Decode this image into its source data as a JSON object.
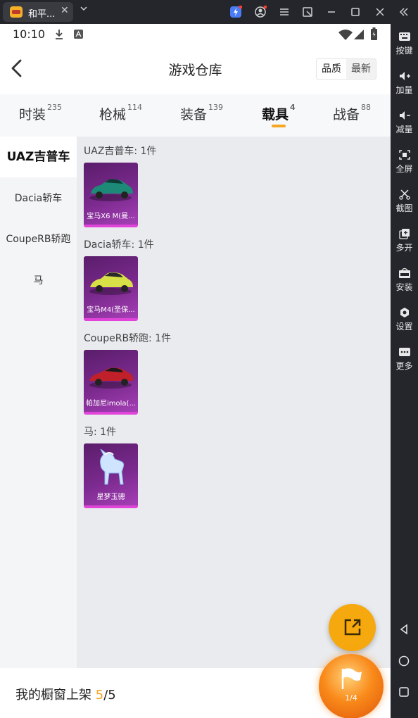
{
  "window": {
    "app_title": "和平...",
    "tab_close": "✕"
  },
  "sidebar": {
    "items": [
      {
        "label": "按键",
        "icon": "keyboard-icon"
      },
      {
        "label": "加量",
        "icon": "volume-up-icon"
      },
      {
        "label": "减量",
        "icon": "volume-down-icon"
      },
      {
        "label": "全屏",
        "icon": "fullscreen-icon"
      },
      {
        "label": "截图",
        "icon": "scissors-icon"
      },
      {
        "label": "多开",
        "icon": "multi-instance-icon"
      },
      {
        "label": "安装",
        "icon": "apk-icon"
      },
      {
        "label": "设置",
        "icon": "gear-icon"
      },
      {
        "label": "更多",
        "icon": "more-icon"
      }
    ]
  },
  "status": {
    "time": "10:10"
  },
  "header": {
    "title": "游戏仓库",
    "sort_quality": "品质",
    "sort_latest": "最新"
  },
  "tabs": [
    {
      "label": "时装",
      "count": "235"
    },
    {
      "label": "枪械",
      "count": "114"
    },
    {
      "label": "装备",
      "count": "139"
    },
    {
      "label": "载具",
      "count": "4",
      "active": true
    },
    {
      "label": "战备",
      "count": "88"
    }
  ],
  "categories": [
    "UAZ吉普车",
    "Dacia轿车",
    "CoupeRB轿跑",
    "马"
  ],
  "groups": [
    {
      "title": "UAZ吉普车: 1件",
      "item": "宝马X6 M(曼..."
    },
    {
      "title": "Dacia轿车: 1件",
      "item": "宝马M4(圣保..."
    },
    {
      "title": "CoupeRB轿跑: 1件",
      "item": "帕加尼imola(..."
    },
    {
      "title": "马: 1件",
      "item": "星梦玉骢"
    }
  ],
  "bottom": {
    "shelf_label": "我的橱窗上架 ",
    "shelf_count": "5",
    "shelf_total": "/5"
  },
  "flag_counter": "1/4",
  "colors": {
    "accent": "#f5a623",
    "card_border": "#e044d8",
    "chrome": "#25262b"
  }
}
